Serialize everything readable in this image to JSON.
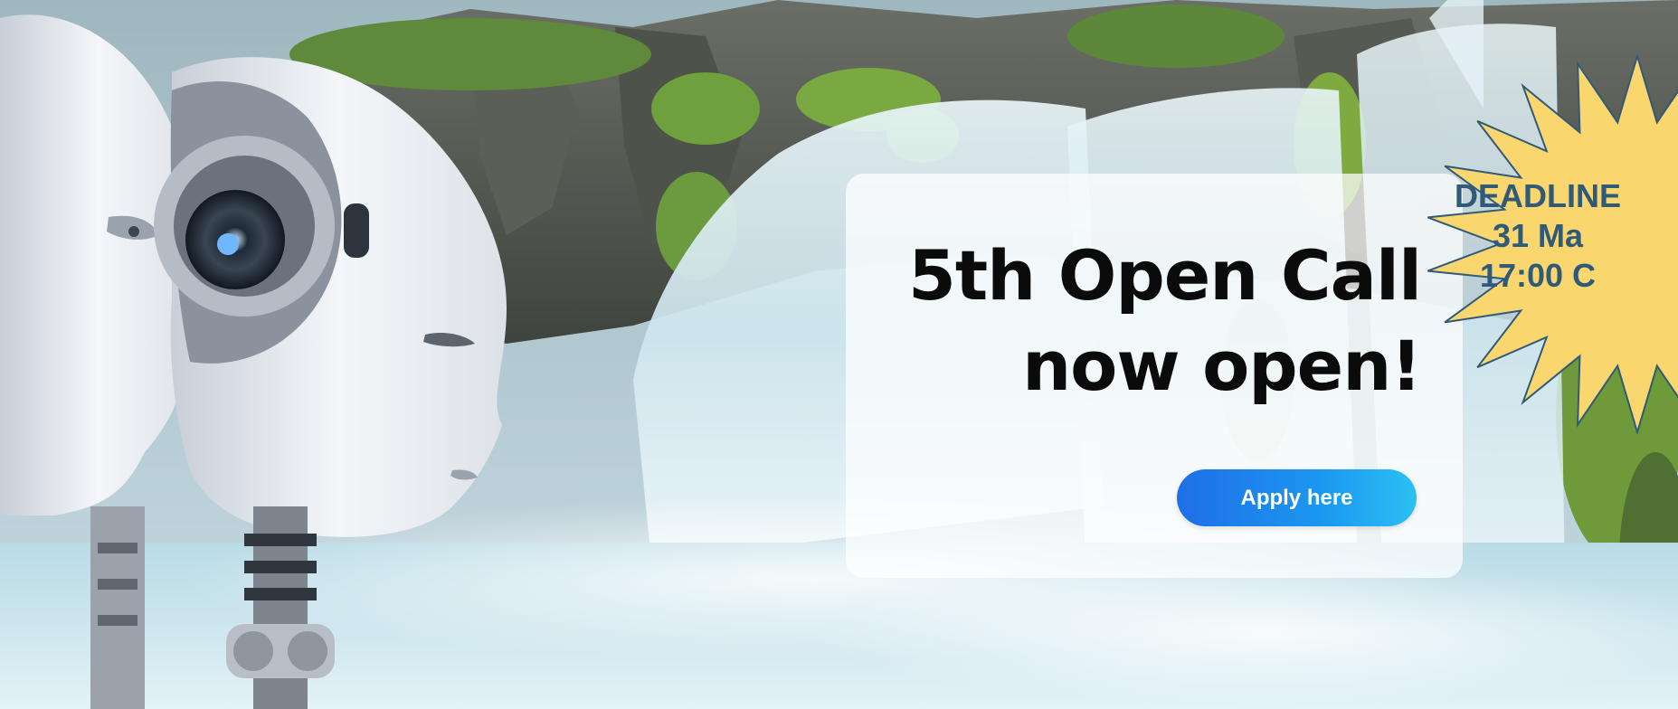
{
  "banner": {
    "headline_line1": "5th Open Call",
    "headline_line2": "now open!",
    "apply_label": "Apply here"
  },
  "deadline_badge": {
    "line1": "DEADLINE",
    "line2": "31 Ma",
    "line3": "17:00 C",
    "fill_color": "#fad66f",
    "stroke_color": "#2f5a78",
    "text_color": "#2f5a78"
  },
  "colors": {
    "button_gradient_start": "#1f6fe6",
    "button_gradient_end": "#2bc0f3",
    "headline": "#0b0b0b",
    "card_background": "#ffffff"
  },
  "icons": {
    "badge_shape": "starburst-icon"
  }
}
